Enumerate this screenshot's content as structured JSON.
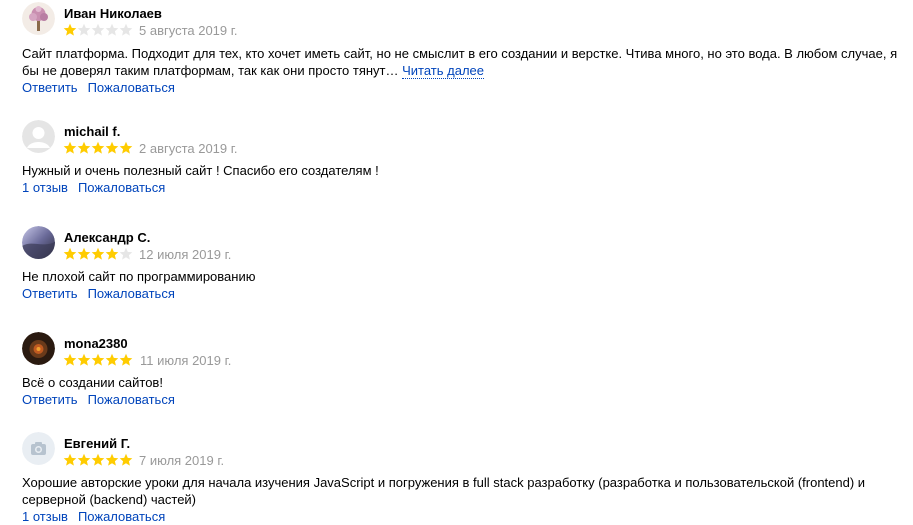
{
  "colors": {
    "star_filled": "#ffcc00",
    "star_empty": "#e6e6e6",
    "link": "#0044bb",
    "date": "#999999"
  },
  "reviews": [
    {
      "author": "Иван Николаев",
      "rating": 1,
      "date": "5 августа 2019 г.",
      "text": "Сайт платформа. Подходит для тех, кто хочет иметь сайт, но не смыслит в его создании и верстке. Чтива много, но это вода. В любом случае, я бы не доверял таким платформам, так как они просто тянут… ",
      "read_more": "Читать далее",
      "action_1": "Ответить",
      "action_2": "Пожаловаться",
      "avatar": "tree-avatar-icon"
    },
    {
      "author": "michail f.",
      "rating": 5,
      "date": "2 августа 2019 г.",
      "text": "Нужный и очень полезный сайт ! Спасибо его создателям !",
      "action_1": "1 отзыв",
      "action_2": "Пожаловаться",
      "avatar": "default-user-avatar-icon"
    },
    {
      "author": "Александр С.",
      "rating": 4,
      "date": "12 июля 2019 г.",
      "text": "Не плохой сайт по программированию",
      "action_1": "Ответить",
      "action_2": "Пожаловаться",
      "avatar": "photo-avatar-icon"
    },
    {
      "author": "mona2380",
      "rating": 5,
      "date": "11 июля 2019 г.",
      "text": "Всё о создании сайтов!",
      "action_1": "Ответить",
      "action_2": "Пожаловаться",
      "avatar": "dark-photo-avatar-icon"
    },
    {
      "author": "Евгений Г.",
      "rating": 5,
      "date": "7 июля 2019 г.",
      "text": "Хорошие авторские уроки для начала изучения JavaScript и погружения в full stack разработку (разработка и пользовательской (frontend) и серверной (backend) частей)",
      "action_1": "1 отзыв",
      "action_2": "Пожаловаться",
      "avatar": "camera-avatar-icon"
    }
  ]
}
